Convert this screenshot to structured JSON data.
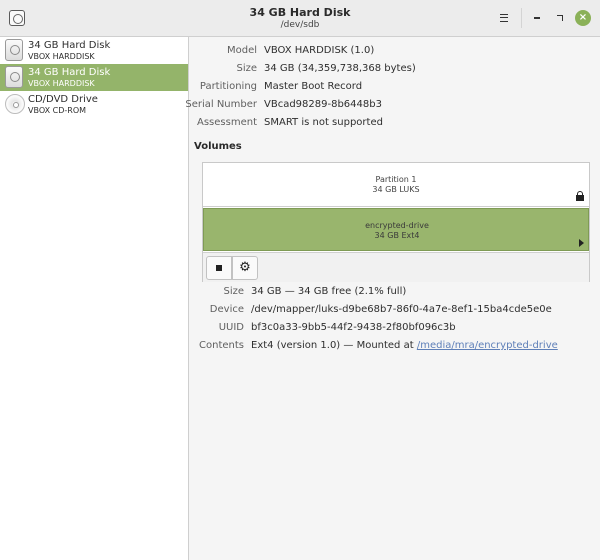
{
  "window": {
    "title": "34 GB Hard Disk",
    "subtitle": "/dev/sdb"
  },
  "sidebar": {
    "items": [
      {
        "name": "34 GB Hard Disk",
        "sub": "VBOX HARDDISK",
        "icon": "hard-disk-icon",
        "selected": false
      },
      {
        "name": "34 GB Hard Disk",
        "sub": "VBOX HARDDISK",
        "icon": "hard-disk-icon",
        "selected": true
      },
      {
        "name": "CD/DVD Drive",
        "sub": "VBOX CD-ROM",
        "icon": "optical-disc-icon",
        "selected": false
      }
    ]
  },
  "drive": {
    "model_label": "Model",
    "model": "VBOX HARDDISK (1.0)",
    "size_label": "Size",
    "size": "34 GB (34,359,738,368 bytes)",
    "partitioning_label": "Partitioning",
    "partitioning": "Master Boot Record",
    "serial_label": "Serial Number",
    "serial": "VBcad98289-8b6448b3",
    "assessment_label": "Assessment",
    "assessment": "SMART is not supported"
  },
  "volumes": {
    "title": "Volumes",
    "partition": {
      "name": "Partition 1",
      "detail": "34 GB LUKS"
    },
    "inner": {
      "name": "encrypted-drive",
      "detail": "34 GB Ext4"
    },
    "toolbar": {
      "stop_icon": "stop-icon",
      "gear_icon": "gear-icon"
    }
  },
  "selected_volume": {
    "size_label": "Size",
    "size": "34 GB — 34 GB free (2.1% full)",
    "device_label": "Device",
    "device": "/dev/mapper/luks-d9be68b7-86f0-4a7e-8ef1-15ba4cde5e0e",
    "uuid_label": "UUID",
    "uuid": "bf3c0a33-9bb5-44f2-9438-2f80bf096c3b",
    "contents_label": "Contents",
    "contents_prefix": "Ext4 (version 1.0) — Mounted at ",
    "mount_point": "/media/mra/encrypted-drive"
  },
  "colors": {
    "accent": "#94b46a",
    "close_button": "#8bb158",
    "link": "#5e7fb8"
  }
}
